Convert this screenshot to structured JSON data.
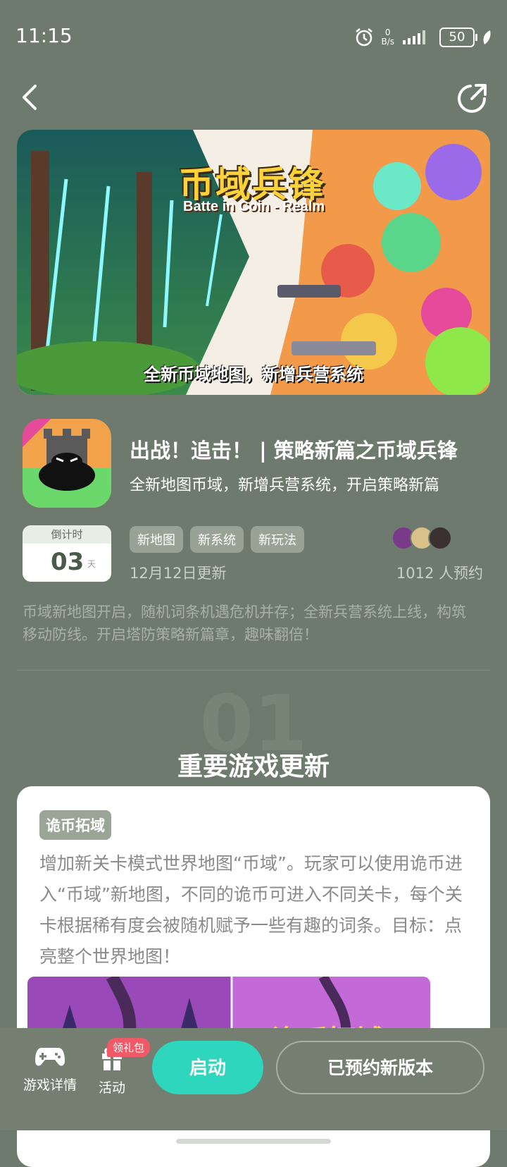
{
  "status": {
    "time": "11:15",
    "net_speed_value": "0",
    "net_speed_unit": "B/s",
    "battery": "50",
    "icons": [
      "alarm-icon",
      "signal-icon",
      "battery-icon",
      "leaf-icon"
    ]
  },
  "nav": {
    "back_icon": "chevron-left-icon",
    "share_icon": "share-icon"
  },
  "banner": {
    "title": "币域兵锋",
    "subtitle": "Batte in Coin - Realm",
    "caption": "全新币域地图，新增兵营系统"
  },
  "game": {
    "title": "出战！追击！ | 策略新篇之币域兵锋",
    "subtitle": "全新地图币域，新增兵营系统，开启策略新篇"
  },
  "countdown": {
    "label": "倒计时",
    "value": "03",
    "unit": "天"
  },
  "tags": [
    "新地图",
    "新系统",
    "新玩法"
  ],
  "update_date": "12月12日更新",
  "reserve_count": "1012 人预约",
  "description": "币域新地图开启，随机词条机遇危机并存；全新兵营系统上线，构筑移动防线。开启塔防策略新篇章，趣味翻倍！",
  "section": {
    "number": "01",
    "title": "重要游戏更新"
  },
  "card": {
    "tag": "诡币拓域",
    "text": "增加新关卡模式世界地图“币域”。玩家可以使用诡币进入“币域”新地图，不同的诡币可进入不同关卡，每个关卡根据稀有度会被随机赋予一些有趣的词条。目标：点亮整个世界地图！",
    "image_title": "诡币拓域"
  },
  "bottom": {
    "details_label": "游戏详情",
    "activity_label": "活动",
    "gift_badge": "领礼包",
    "launch_label": "启动",
    "reserved_label": "已预约新版本"
  },
  "colors": {
    "background": "#6e7a6d",
    "accent": "#2fd6be",
    "badge": "#f05a66",
    "tag": "#98a396"
  }
}
